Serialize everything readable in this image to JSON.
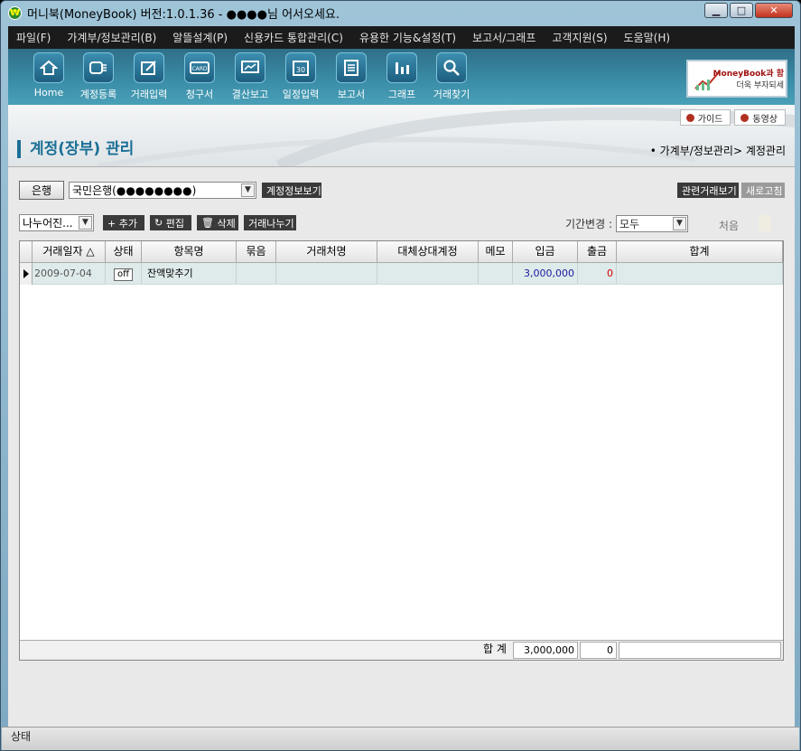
{
  "window": {
    "title": "머니북(MoneyBook) 버전:1.0.1.36 - ●●●●님 어서오세요.",
    "controls": {
      "minimize": "▁",
      "maximize": "□",
      "close": "✕"
    }
  },
  "menu": [
    "파일(F)",
    "가계부/정보관리(B)",
    "알뜰설계(P)",
    "신용카드 통합관리(C)",
    "유용한 기능&설정(T)",
    "보고서/그래프",
    "고객지원(S)",
    "도움말(H)"
  ],
  "toolbar": [
    {
      "label": "Home",
      "icon": "home-icon"
    },
    {
      "label": "계정등록",
      "icon": "account-register-icon"
    },
    {
      "label": "거래입력",
      "icon": "transaction-edit-icon"
    },
    {
      "label": "청구서",
      "icon": "card-bill-icon"
    },
    {
      "label": "결산보고",
      "icon": "monitor-report-icon"
    },
    {
      "label": "일정입력",
      "icon": "calendar-icon"
    },
    {
      "label": "보고서",
      "icon": "document-icon"
    },
    {
      "label": "그래프",
      "icon": "bar-chart-icon"
    },
    {
      "label": "거래찾기",
      "icon": "search-icon"
    }
  ],
  "banner": {
    "line1": "MoneyBook과 함",
    "line2": "더욱 부자되세"
  },
  "guide_buttons": {
    "guide": "가이드",
    "video": "동영상"
  },
  "page": {
    "title": "계정(장부) 관리",
    "breadcrumb": "• 가계부/정보관리> 계정관리"
  },
  "controls": {
    "bank_button": "은행",
    "account_select": "국민은행(●●●●●●●●)",
    "view_account_info": "계정정보보기",
    "related_tx_view": "관련거래보기",
    "refresh": "새로고침",
    "split_select": "나누어진...",
    "add": "+ 추가",
    "edit": "편집",
    "delete": "삭제",
    "split_tx": "거래나누기",
    "period_label": "기간변경 :",
    "period_value": "모두",
    "first_label": "처음"
  },
  "grid": {
    "columns": [
      "거래일자 △",
      "상태",
      "항목명",
      "묶음",
      "거래처명",
      "대체상대계정",
      "메모",
      "입금",
      "출금",
      "합계"
    ],
    "rows": [
      {
        "date": "2009-07-04",
        "status": "off",
        "item": "잔액맞추기",
        "group": "",
        "payee": "",
        "transfer": "",
        "memo": "",
        "deposit": "3,000,000",
        "withdraw": "0",
        "total": ""
      }
    ],
    "footer": {
      "label": "합 계",
      "deposit_total": "3,000,000",
      "withdraw_total": "0",
      "total": ""
    }
  },
  "status_bar": "상태",
  "colors": {
    "accent": "#1a6f95",
    "toolbar": "#3b8ea8",
    "deposit": "#1a1aa0",
    "withdraw": "#d00000",
    "row_highlight": "#dfeaea"
  }
}
